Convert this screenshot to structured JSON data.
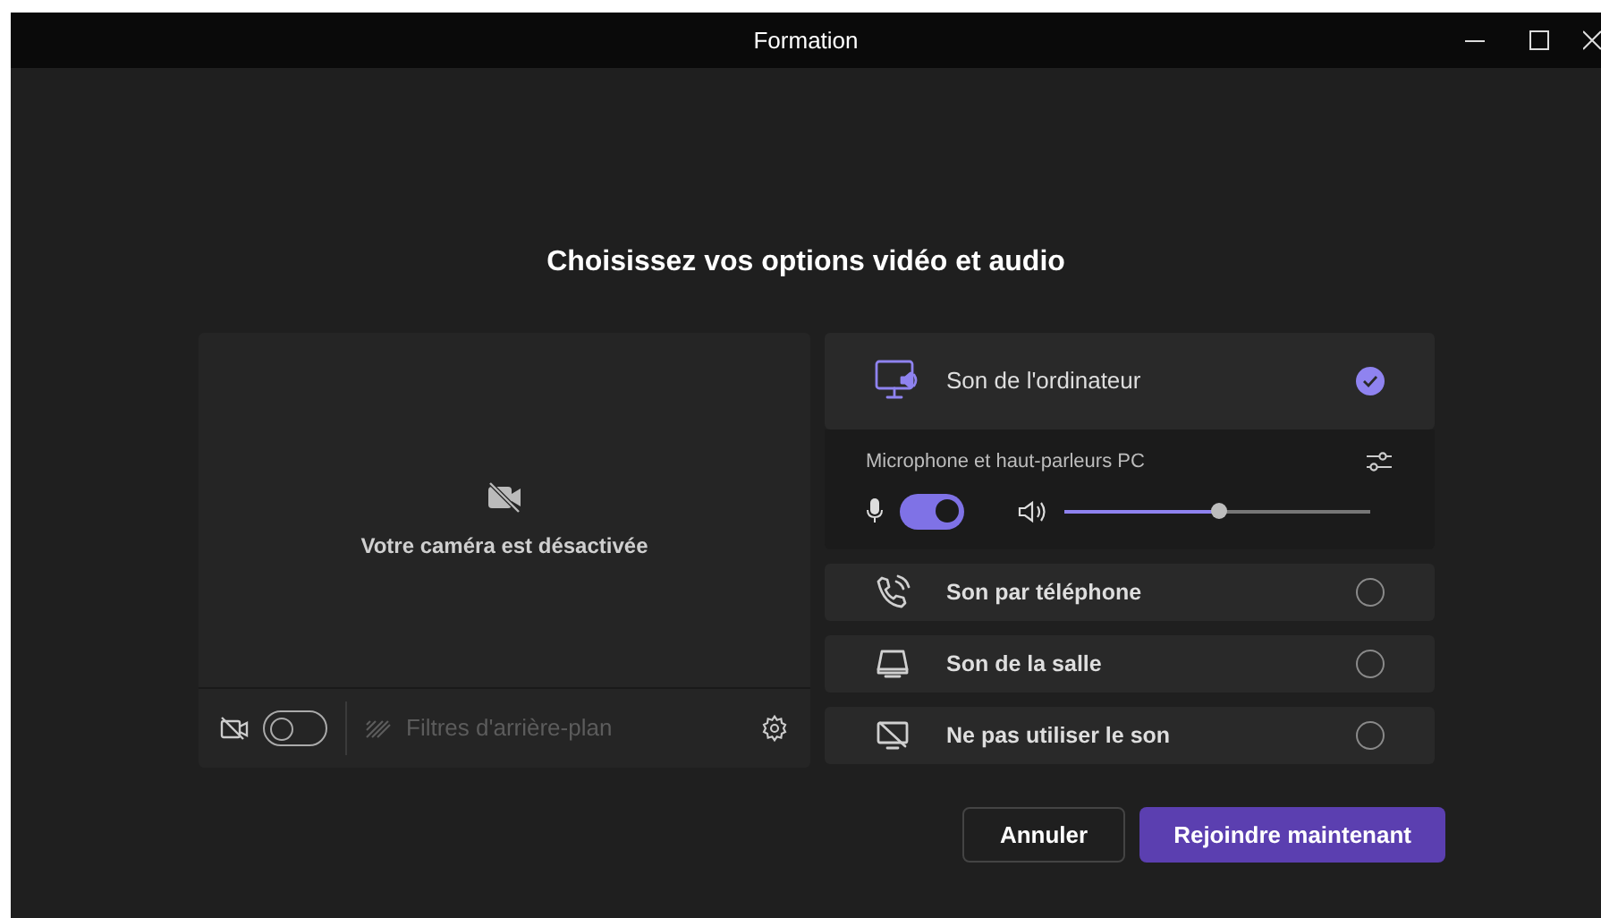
{
  "window": {
    "title": "Formation"
  },
  "heading": "Choisissez vos options vidéo et audio",
  "camera": {
    "status": "Votre caméra est désactivée",
    "on": false,
    "filters": {
      "label": "Filtres d'arrière-plan",
      "disabled": true
    }
  },
  "audio_options": [
    {
      "kind": "computer",
      "label": "Son de l'ordinateur",
      "selected": true,
      "device": "Microphone et haut-parleurs PC",
      "mic_on": true,
      "volume": {
        "level": 0.5
      }
    },
    {
      "kind": "phone",
      "label": "Son par téléphone",
      "selected": false
    },
    {
      "kind": "room",
      "label": "Son de la salle",
      "selected": false
    },
    {
      "kind": "none",
      "label": "Ne pas utiliser le son",
      "selected": false
    }
  ],
  "buttons": [
    {
      "label": "Annuler",
      "kind": "secondary"
    },
    {
      "label": "Rejoindre maintenant",
      "kind": "primary"
    }
  ]
}
